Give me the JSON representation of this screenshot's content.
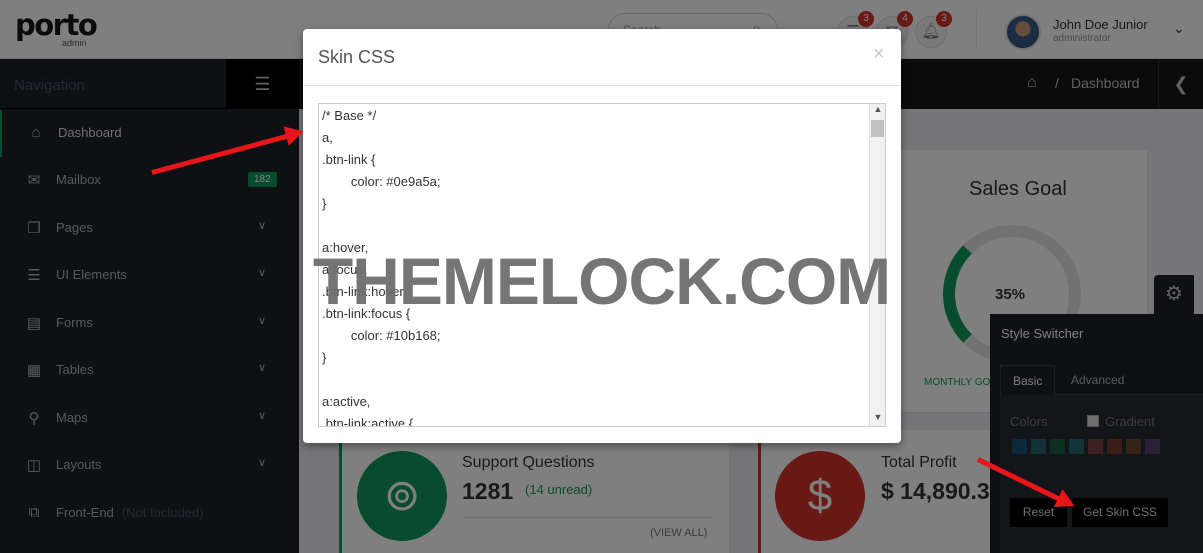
{
  "header": {
    "logo": "porto",
    "logo_sub": "admin",
    "search_placeholder": "Search...",
    "notifications": [
      {
        "icon": "tasks-icon",
        "count": "3"
      },
      {
        "icon": "envelope-icon",
        "count": "4"
      },
      {
        "icon": "bell-icon",
        "count": "3"
      }
    ],
    "user_name": "John Doe Junior",
    "user_role": "administrator"
  },
  "sidebar": {
    "title": "Navigation",
    "items": [
      {
        "icon": "home-icon",
        "label": "Dashboard",
        "active": true
      },
      {
        "icon": "envelope-icon",
        "label": "Mailbox",
        "badge": "182"
      },
      {
        "icon": "copy-icon",
        "label": "Pages",
        "chevron": true
      },
      {
        "icon": "tasks-icon",
        "label": "UI Elements",
        "chevron": true
      },
      {
        "icon": "list-alt-icon",
        "label": "Forms",
        "chevron": true
      },
      {
        "icon": "table-icon",
        "label": "Tables",
        "chevron": true
      },
      {
        "icon": "map-marker-icon",
        "label": "Maps",
        "chevron": true
      },
      {
        "icon": "columns-icon",
        "label": "Layouts",
        "chevron": true
      },
      {
        "icon": "external-link-icon",
        "label": "Front-End",
        "note": "(Not Included)"
      }
    ]
  },
  "breadcrumb": {
    "current": "Dashboard"
  },
  "dashboard": {
    "sales_goal": {
      "title": "Sales Goal",
      "percent": "35%",
      "progress": 0.35,
      "label": "MONTHLY GO"
    },
    "support": {
      "title": "Support Questions",
      "value": "1281",
      "sub": "(14 unread)",
      "link": "(VIEW ALL)"
    },
    "profit": {
      "title": "Total Profit",
      "value": "$ 14,890.3"
    }
  },
  "style_switcher": {
    "title": "Style Switcher",
    "tabs": [
      "Basic",
      "Advanced"
    ],
    "colors_label": "Colors",
    "gradient_label": "Gradient",
    "swatches": [
      "#0088cc",
      "#2baab1",
      "#0e9a5a",
      "#21b3c6",
      "#e36159",
      "#d64b28",
      "#b46a37",
      "#9360b6"
    ],
    "reset_label": "Reset",
    "get_css_label": "Get Skin CSS"
  },
  "modal": {
    "title": "Skin CSS",
    "close": "×",
    "code": [
      "/* Base */",
      "a,",
      ".btn-link {",
      "\tcolor: #0e9a5a;",
      "}",
      "",
      "a:hover,",
      "a:focus,",
      ".btn-link:hover,",
      ".btn-link:focus {",
      "\tcolor: #10b168;",
      "}",
      "",
      "a:active,",
      ".btn-link:active {"
    ]
  },
  "watermark": "THEMELOCK.COM",
  "colors": {
    "accent": "#0e9a5a",
    "sidebar": "#1d2127",
    "arrow": "#e8151b",
    "profit": "#d2322d"
  }
}
